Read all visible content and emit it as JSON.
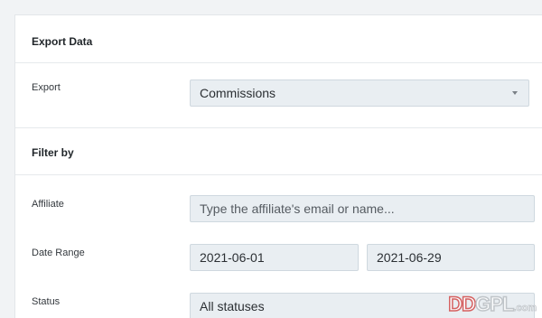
{
  "export_section": {
    "title": "Export Data",
    "export_label": "Export",
    "export_value": "Commissions"
  },
  "filter_section": {
    "title": "Filter by",
    "affiliate_label": "Affiliate",
    "affiliate_placeholder": "Type the affiliate's email or name...",
    "date_range_label": "Date Range",
    "date_start": "2021-06-01",
    "date_end": "2021-06-29",
    "status_label": "Status",
    "status_value": "All statuses"
  },
  "watermark": {
    "part1": "DD",
    "part2": "GPL",
    "part3": ".com"
  }
}
